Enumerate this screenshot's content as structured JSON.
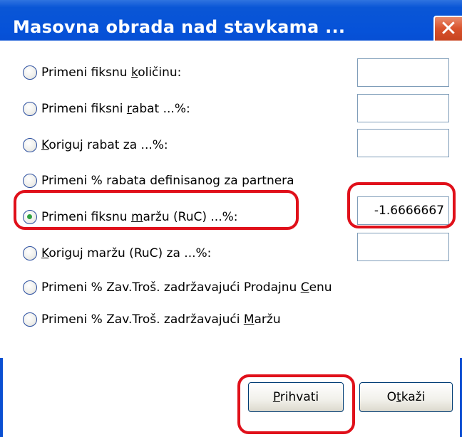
{
  "window": {
    "title": "Masovna obrada nad stavkama ...",
    "close_glyph": "✕"
  },
  "options": [
    {
      "pre": "Primeni fiksnu ",
      "acc": "k",
      "post": "oličinu:",
      "checked": false,
      "field": ""
    },
    {
      "pre": "Primeni fiksni ",
      "acc": "r",
      "post": "abat ...%:",
      "checked": false,
      "field": ""
    },
    {
      "pre": "",
      "acc": "K",
      "post": "origuj rabat za ...%:",
      "checked": false,
      "field": ""
    },
    {
      "pre": "Primeni % rabata definisanog za partnera",
      "acc": "",
      "post": "",
      "checked": false
    },
    {
      "pre": "Primeni fiksnu ",
      "acc": "m",
      "post": "aržu (RuC) ...%:",
      "checked": true,
      "field": "-1.6666667"
    },
    {
      "pre": "",
      "acc": "K",
      "post": "origuj maržu (RuC) za ...%:",
      "checked": false,
      "field": ""
    },
    {
      "pre": "Primeni % Zav.Troš. zadržavajući Prodajnu ",
      "acc": "C",
      "post": "enu",
      "checked": false
    },
    {
      "pre": "Primeni % Zav.Troš. zadržavajući  ",
      "acc": "M",
      "post": "aržu",
      "checked": false
    }
  ],
  "buttons": {
    "accept": {
      "acc": "P",
      "rest": "rihvati"
    },
    "cancel": {
      "pre": "O",
      "acc": "t",
      "rest": "kaži"
    }
  },
  "colors": {
    "titlebar": "#0652d8",
    "highlight": "#e0101a",
    "radio_dot": "#2fa140"
  }
}
